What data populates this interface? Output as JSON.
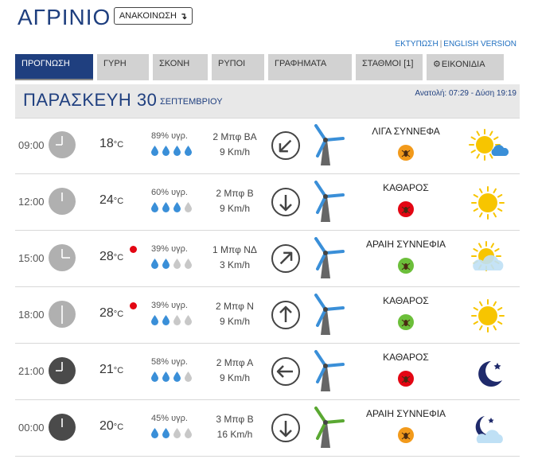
{
  "header": {
    "title": "ΑΓΡΙΝΙΟ",
    "announce_label": "ΑΝΑΚΟΙΝΩΣΗ",
    "announce_arrow": "↴",
    "print_link": "ΕΚΤΥΠΩΣΗ",
    "link_sep": "|",
    "english_link": "ENGLISH VERSION"
  },
  "tabs": [
    {
      "label": "ΠΡΟΓΝΩΣΗ",
      "active": true
    },
    {
      "label": "ΓΥΡΗ",
      "active": false
    },
    {
      "label": "ΣΚΟΝΗ",
      "active": false
    },
    {
      "label": "ΡΥΠΟΙ",
      "active": false
    },
    {
      "label": "ΓΡΑΦΗΜΑΤΑ",
      "active": false
    },
    {
      "label": "ΣΤΑΘΜΟΙ [1]",
      "active": false
    },
    {
      "label": "ΕΙΚΟΝΙΔΙΑ",
      "active": false,
      "icon": "gear-icon"
    }
  ],
  "day": {
    "name": "ΠΑΡΑΣΚΕΥΗ 30",
    "month": "ΣΕΠΤΕΜΒΡΙΟΥ",
    "sun": "Ανατολή: 07:29  - Δύση 19:19"
  },
  "unit": "°C",
  "colors": {
    "accent": "#1f3f7f",
    "drop_on": "#3a8fd8",
    "drop_off": "#c8c8c8",
    "warn_red": "#e30613"
  },
  "rows": [
    {
      "time": "09:00",
      "night": false,
      "temp": "18",
      "hot": false,
      "humidity": "89% υγρ.",
      "drops": 4,
      "beaufort": "2 Μπφ ΒΑ",
      "speed": "9 Km/h",
      "arrow": "arrow-southwest-icon",
      "turbine_color": "grey",
      "condition": "ΛΙΓΑ ΣΥΝΝΕΦΑ",
      "badge": "orange",
      "icon": "sun-cloud-icon"
    },
    {
      "time": "12:00",
      "night": false,
      "temp": "24",
      "hot": false,
      "humidity": "60% υγρ.",
      "drops": 3,
      "beaufort": "2 Μπφ Β",
      "speed": "9 Km/h",
      "arrow": "arrow-down-icon",
      "turbine_color": "grey",
      "condition": "ΚΑΘΑΡΟΣ",
      "badge": "red",
      "icon": "sun-icon"
    },
    {
      "time": "15:00",
      "night": false,
      "temp": "28",
      "hot": true,
      "humidity": "39% υγρ.",
      "drops": 2,
      "beaufort": "1 Μπφ ΝΔ",
      "speed": "3 Km/h",
      "arrow": "arrow-northeast-icon",
      "turbine_color": "grey",
      "condition": "ΑΡΑΙΗ ΣΥΝΝΕΦΙΑ",
      "badge": "green",
      "icon": "sun-behind-cloud-icon"
    },
    {
      "time": "18:00",
      "night": false,
      "temp": "28",
      "hot": true,
      "humidity": "39% υγρ.",
      "drops": 2,
      "beaufort": "2 Μπφ Ν",
      "speed": "9 Km/h",
      "arrow": "arrow-up-icon",
      "turbine_color": "grey",
      "condition": "ΚΑΘΑΡΟΣ",
      "badge": "green",
      "icon": "sun-icon"
    },
    {
      "time": "21:00",
      "night": true,
      "temp": "21",
      "hot": false,
      "humidity": "58% υγρ.",
      "drops": 3,
      "beaufort": "2 Μπφ Α",
      "speed": "9 Km/h",
      "arrow": "arrow-left-icon",
      "turbine_color": "grey",
      "condition": "ΚΑΘΑΡΟΣ",
      "badge": "red",
      "icon": "moon-icon"
    },
    {
      "time": "00:00",
      "night": true,
      "temp": "20",
      "hot": false,
      "humidity": "45% υγρ.",
      "drops": 2,
      "beaufort": "3 Μπφ Β",
      "speed": "16 Km/h",
      "arrow": "arrow-down-icon",
      "turbine_color": "green",
      "condition": "ΑΡΑΙΗ ΣΥΝΝΕΦΙΑ",
      "badge": "orange",
      "icon": "moon-cloud-icon"
    }
  ]
}
